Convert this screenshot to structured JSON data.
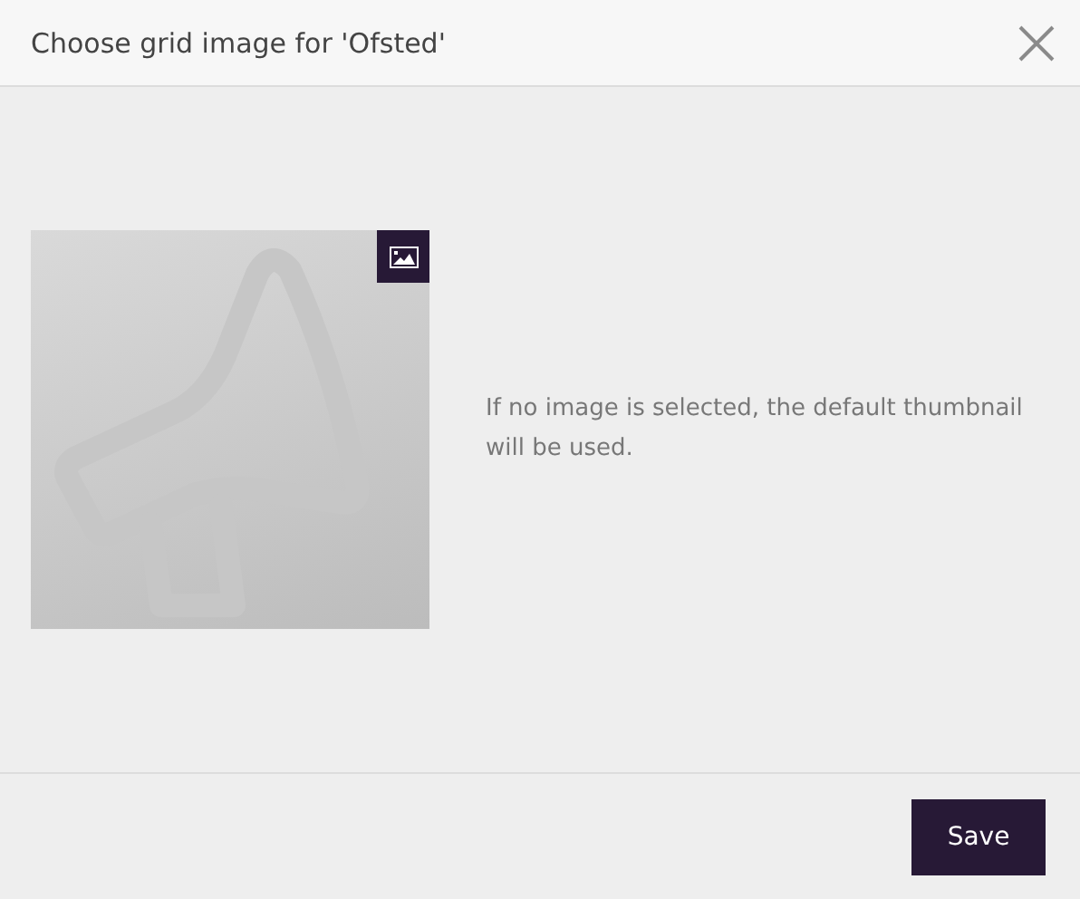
{
  "dialog": {
    "title": "Choose grid image for 'Ofsted'"
  },
  "image": {
    "kind": "placeholder"
  },
  "hint": "If no image is selected, the default thumbnail will be used.",
  "buttons": [
    {
      "label": "Save"
    }
  ]
}
